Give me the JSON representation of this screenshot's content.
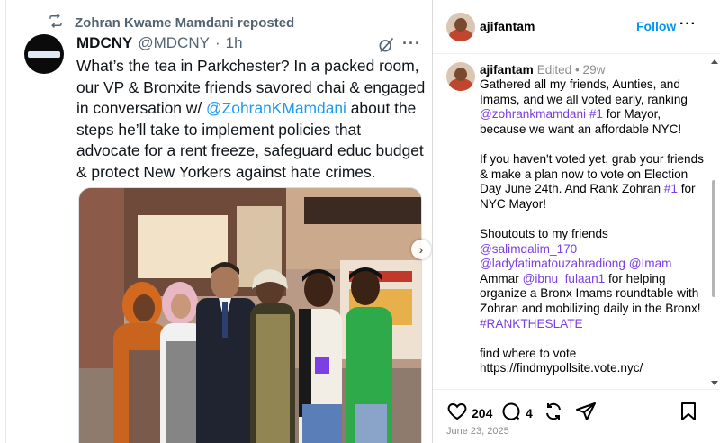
{
  "tweet": {
    "repost_label": "Zohran Kwame Mamdani reposted",
    "author_name": "MDCNY",
    "author_handle": "@MDCNY",
    "separator": "·",
    "time": "1h",
    "more": "···",
    "text_before": "What’s the tea in Parkchester? In a packed room, our VP & Bronxite friends savored chai & engaged in conversation w/ ",
    "mention": "@ZohranKMamdani",
    "text_after": " about the steps he’ll take to implement policies that advocate for a rent freeze, safeguard educ budget & protect New Yorkers against hate crimes.",
    "carousel_next": "›",
    "icons": {
      "repost": "repost-icon",
      "grok": "grok-icon",
      "more": "more-icon",
      "next": "chevron-right-icon"
    },
    "colors": {
      "mention": "#1d9bf0",
      "secondary": "#536471"
    }
  },
  "instagram": {
    "username": "ajifantam",
    "follow_label": "Follow",
    "more": "···",
    "caption_meta": "Edited • 29w",
    "caption_paragraph_1_pre": "Gathered all my friends, Aunties, and Imams, and we all voted early, ranking ",
    "caption_paragraph_1_tag": "@zohrankmamdani #1",
    "caption_paragraph_1_post": " for Mayor, because we want an affordable NYC!",
    "caption_paragraph_2_pre": "If you haven't voted yet, grab your friends & make a plan now to vote on Election Day June 24th. And Rank Zohran ",
    "caption_paragraph_2_tag": "#1",
    "caption_paragraph_2_post": " for NYC Mayor!",
    "caption_paragraph_3_pre": "Shoutouts to my friends ",
    "caption_tag_salim": "@salimdalim_170",
    "caption_tag_lady": "@ladyfatimatouzahradiong",
    "caption_tag_imam": "@Imam",
    "caption_paragraph_3_mid": " Ammar ",
    "caption_tag_ibnu": "@ibnu_fulaan1",
    "caption_paragraph_3_post": "  for helping organize a Bronx Imams roundtable with Zohran and mobilizing daily in the Bronx! ",
    "caption_tag_rank": "#RANKTHESLATE",
    "caption_paragraph_4": "find where to vote https://findmypollsite.vote.nyc/",
    "likes": "204",
    "comments": "4",
    "date": "June 23, 2025",
    "icons": {
      "like": "heart-icon",
      "comment": "comment-icon",
      "repost": "repost-icon",
      "share": "share-icon",
      "save": "bookmark-icon"
    },
    "colors": {
      "follow": "#0095f6",
      "tag": "#7b3fe4",
      "meta": "#8e8e8e"
    }
  }
}
